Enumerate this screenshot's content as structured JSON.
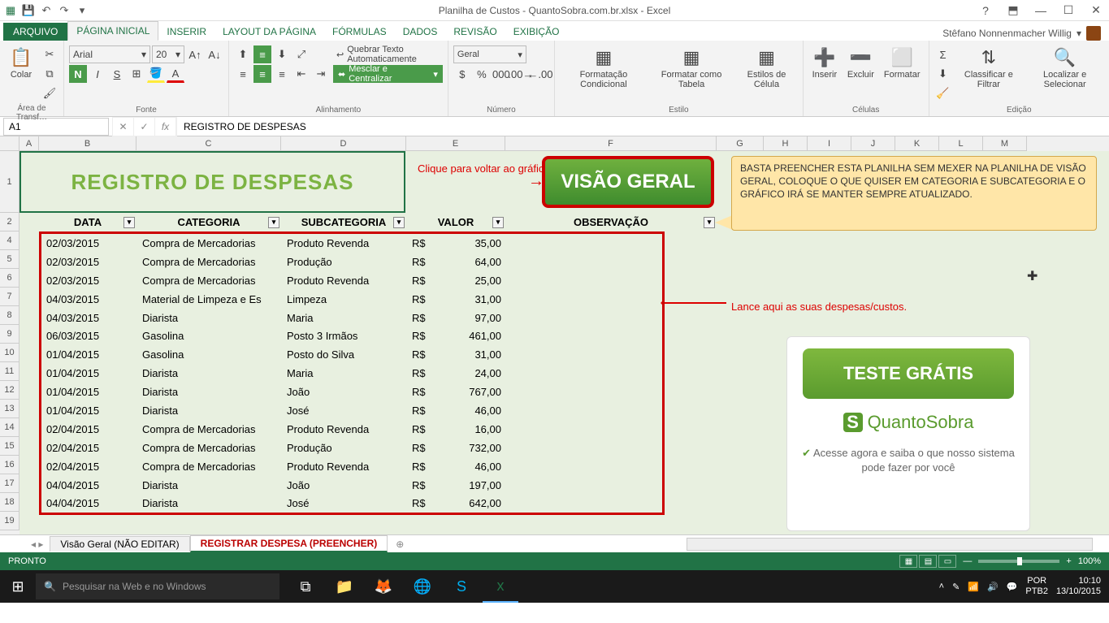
{
  "title": "Planilha de Custos - QuantoSobra.com.br.xlsx - Excel",
  "user": "Stêfano Nonnenmacher Willig",
  "tabs": {
    "file": "ARQUIVO",
    "t1": "PÁGINA INICIAL",
    "t2": "INSERIR",
    "t3": "LAYOUT DA PÁGINA",
    "t4": "FÓRMULAS",
    "t5": "DADOS",
    "t6": "REVISÃO",
    "t7": "EXIBIÇÃO"
  },
  "ribbon": {
    "paste": "Colar",
    "clipboard": "Área de Transf…",
    "font": "Arial",
    "size": "20",
    "fontGroup": "Fonte",
    "wrap": "Quebrar Texto Automaticamente",
    "merge": "Mesclar e Centralizar",
    "alignGroup": "Alinhamento",
    "numFmt": "Geral",
    "numGroup": "Número",
    "condFmt": "Formatação Condicional",
    "asTable": "Formatar como Tabela",
    "cellStyles": "Estilos de Célula",
    "styleGroup": "Estilo",
    "insert": "Inserir",
    "delete": "Excluir",
    "format": "Formatar",
    "cellsGroup": "Células",
    "sortFilter": "Classificar e Filtrar",
    "findSelect": "Localizar e Selecionar",
    "editGroup": "Edição"
  },
  "nameBox": "A1",
  "formula": "REGISTRO DE DESPESAS",
  "cols": [
    "A",
    "B",
    "C",
    "D",
    "E",
    "F",
    "G",
    "H",
    "I",
    "J",
    "K",
    "L",
    "M"
  ],
  "rows": [
    "1",
    "2",
    "4",
    "5",
    "6",
    "7",
    "8",
    "9",
    "10",
    "11",
    "12",
    "13",
    "14",
    "15",
    "16",
    "17",
    "18",
    "19"
  ],
  "sheetTitle": "REGISTRO DE DESPESAS",
  "hint": "Clique para voltar ao gráfico",
  "visaoBtn": "VISÃO GERAL",
  "note": "BASTA PREENCHER ESTA PLANILHA SEM MEXER NA PLANILHA DE VISÃO GERAL, COLOQUE O QUE QUISER EM CATEGORIA E SUBCATEGORIA E O GRÁFICO IRÁ SE MANTER SEMPRE ATUALIZADO.",
  "lance": "Lance aqui as suas despesas/custos.",
  "headers": {
    "data": "DATA",
    "cat": "CATEGORIA",
    "sub": "SUBCATEGORIA",
    "valor": "VALOR",
    "obs": "OBSERVAÇÃO"
  },
  "data": [
    {
      "data": "02/03/2015",
      "cat": "Compra de Mercadorias",
      "sub": "Produto Revenda",
      "cur": "R$",
      "val": "35,00"
    },
    {
      "data": "02/03/2015",
      "cat": "Compra de Mercadorias",
      "sub": "Produção",
      "cur": "R$",
      "val": "64,00"
    },
    {
      "data": "02/03/2015",
      "cat": "Compra de Mercadorias",
      "sub": "Produto Revenda",
      "cur": "R$",
      "val": "25,00"
    },
    {
      "data": "04/03/2015",
      "cat": "Material de Limpeza e Es",
      "sub": "Limpeza",
      "cur": "R$",
      "val": "31,00"
    },
    {
      "data": "04/03/2015",
      "cat": "Diarista",
      "sub": "Maria",
      "cur": "R$",
      "val": "97,00"
    },
    {
      "data": "06/03/2015",
      "cat": "Gasolina",
      "sub": "Posto 3 Irmãos",
      "cur": "R$",
      "val": "461,00"
    },
    {
      "data": "01/04/2015",
      "cat": "Gasolina",
      "sub": "Posto do Silva",
      "cur": "R$",
      "val": "31,00"
    },
    {
      "data": "01/04/2015",
      "cat": "Diarista",
      "sub": "Maria",
      "cur": "R$",
      "val": "24,00"
    },
    {
      "data": "01/04/2015",
      "cat": "Diarista",
      "sub": "João",
      "cur": "R$",
      "val": "767,00"
    },
    {
      "data": "01/04/2015",
      "cat": "Diarista",
      "sub": "José",
      "cur": "R$",
      "val": "46,00"
    },
    {
      "data": "02/04/2015",
      "cat": "Compra de Mercadorias",
      "sub": "Produto Revenda",
      "cur": "R$",
      "val": "16,00"
    },
    {
      "data": "02/04/2015",
      "cat": "Compra de Mercadorias",
      "sub": "Produção",
      "cur": "R$",
      "val": "732,00"
    },
    {
      "data": "02/04/2015",
      "cat": "Compra de Mercadorias",
      "sub": "Produto Revenda",
      "cur": "R$",
      "val": "46,00"
    },
    {
      "data": "04/04/2015",
      "cat": "Diarista",
      "sub": "João",
      "cur": "R$",
      "val": "197,00"
    },
    {
      "data": "04/04/2015",
      "cat": "Diarista",
      "sub": "José",
      "cur": "R$",
      "val": "642,00"
    }
  ],
  "promo": {
    "teste": "TESTE GRÁTIS",
    "brand": "QuantoSobra",
    "text": "Acesse agora e saiba o que nosso sistema pode fazer por você"
  },
  "sheetTabs": {
    "s1": "Visão Geral (NÃO EDITAR)",
    "s2": "REGISTRAR DESPESA (PREENCHER)"
  },
  "status": {
    "ready": "PRONTO",
    "zoom": "100%"
  },
  "taskbar": {
    "search": "Pesquisar na Web e no Windows",
    "lang": "POR",
    "kbd": "PTB2",
    "time": "10:10",
    "date": "13/10/2015"
  }
}
